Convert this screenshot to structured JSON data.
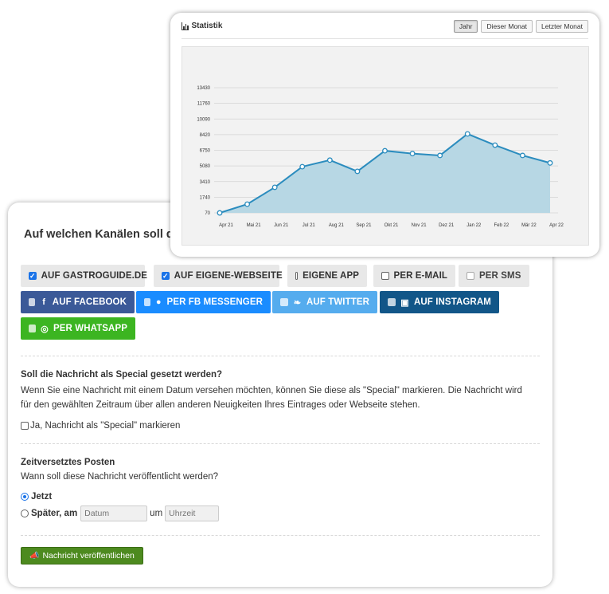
{
  "form": {
    "title": "Auf welchen Kanälen soll die",
    "channels_row1": [
      {
        "label": "AUF GASTROGUIDE.DE",
        "checked": true
      },
      {
        "label": "AUF EIGENE-WEBSEITE",
        "checked": true
      },
      {
        "label": "EIGENE APP",
        "checked": false
      },
      {
        "label": "PER E-MAIL",
        "checked": false
      },
      {
        "label": "PER SMS",
        "checked": false
      }
    ],
    "channels_row2": [
      {
        "label": "AUF FACEBOOK",
        "icon": "facebook-icon",
        "color": "#3b5998"
      },
      {
        "label": "PER FB MESSENGER",
        "icon": "messenger-icon",
        "color": "#1a8cff"
      },
      {
        "label": "AUF TWITTER",
        "icon": "twitter-icon",
        "color": "#55acee"
      },
      {
        "label": "AUF INSTAGRAM",
        "icon": "instagram-icon",
        "color": "#125688"
      }
    ],
    "channels_row3": [
      {
        "label": "PER WHATSAPP",
        "icon": "whatsapp-icon",
        "color": "#3cb521"
      }
    ],
    "special": {
      "heading": "Soll die Nachricht als Special gesetzt werden?",
      "text": "Wenn Sie eine Nachricht mit einem Datum versehen möchten, können Sie diese als \"Special\" markieren. Die Nachricht wird für den gewählten Zeitraum über allen anderen Neuigkeiten Ihres Eintrages oder Webseite stehen.",
      "checkbox_label": "Ja, Nachricht als \"Special\" markieren"
    },
    "posting": {
      "heading": "Zeitversetztes Posten",
      "text": "Wann soll diese Nachricht veröffentlicht werden?",
      "now_label": "Jetzt",
      "later_label": "Später, am",
      "date_placeholder": "Datum",
      "um_label": "um",
      "time_placeholder": "Uhrzeit"
    },
    "publish_label": "Nachricht veröffentlichen"
  },
  "chart_panel": {
    "title": "Statistik",
    "buttons": [
      "Jahr",
      "Dieser Monat",
      "Letzter Monat"
    ],
    "active_button": "Jahr"
  },
  "colors": {
    "line": "#2b8cbe",
    "area": "#b7d7e4",
    "publish": "#4d8a1f"
  },
  "chart_data": {
    "type": "area",
    "title": "Statistik",
    "categories": [
      "Apr 21",
      "Mai 21",
      "Jun 21",
      "Jul 21",
      "Aug 21",
      "Sep 21",
      "Okt 21",
      "Nov 21",
      "Dez 21",
      "Jan 22",
      "Feb 22",
      "Mär 22",
      "Apr 22"
    ],
    "values": [
      70,
      1000,
      2800,
      5000,
      5700,
      4500,
      6700,
      6400,
      6200,
      8500,
      7300,
      6200,
      5400
    ],
    "yticks": [
      "70",
      "1740",
      "3410",
      "5080",
      "6750",
      "8420",
      "10090",
      "11760",
      "13430"
    ],
    "ytick_values": [
      70,
      1740,
      3410,
      5080,
      6750,
      8420,
      10090,
      11760,
      13430
    ],
    "ylim": [
      70,
      13430
    ],
    "xlabel": "",
    "ylabel": "",
    "grid": true,
    "legend": "none"
  }
}
